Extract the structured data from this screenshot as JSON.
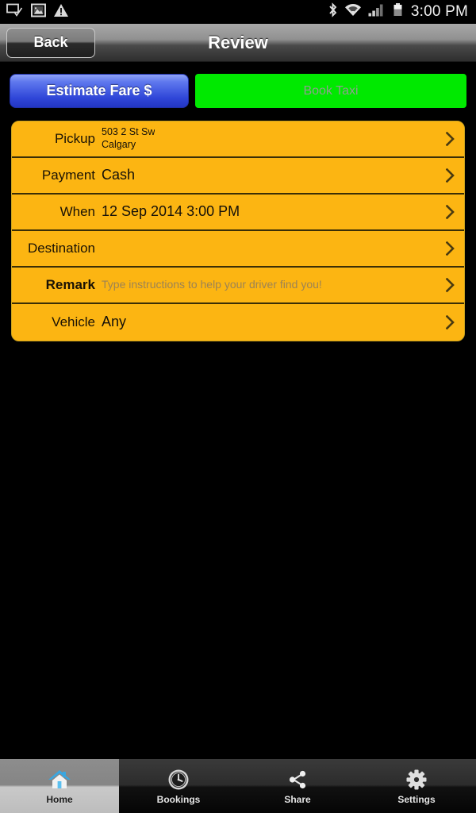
{
  "statusbar": {
    "time": "3:00 PM",
    "left_icons": [
      "message-check-icon",
      "picture-icon",
      "warning-triangle-icon"
    ],
    "right_icons": [
      "bluetooth-icon",
      "wifi-icon",
      "signal-bars-icon",
      "battery-icon"
    ]
  },
  "titlebar": {
    "back_label": "Back",
    "title": "Review"
  },
  "actions": {
    "estimate_label": "Estimate Fare $",
    "estimate_color": "#2f46d8",
    "book_label": "Book Taxi",
    "book_color": "#00e900"
  },
  "form": {
    "panel_color": "#fcb512",
    "rows": [
      {
        "label": "Pickup",
        "value_line1": "503 2 St Sw",
        "value_line2": "Calgary",
        "style": "small"
      },
      {
        "label": "Payment",
        "value": "Cash",
        "style": "normal"
      },
      {
        "label": "When",
        "value": "12 Sep 2014 3:00 PM",
        "style": "normal"
      },
      {
        "label": "Destination",
        "value": "",
        "style": "normal"
      },
      {
        "label": "Remark",
        "value": "Type instructions to help your driver find you!",
        "style": "placeholder"
      },
      {
        "label": "Vehicle",
        "value": "Any",
        "style": "normal"
      }
    ]
  },
  "tabbar": {
    "tabs": [
      {
        "label": "Home",
        "icon": "home-icon",
        "active": true
      },
      {
        "label": "Bookings",
        "icon": "clock-icon",
        "active": false
      },
      {
        "label": "Share",
        "icon": "share-icon",
        "active": false
      },
      {
        "label": "Settings",
        "icon": "gear-icon",
        "active": false
      }
    ]
  }
}
